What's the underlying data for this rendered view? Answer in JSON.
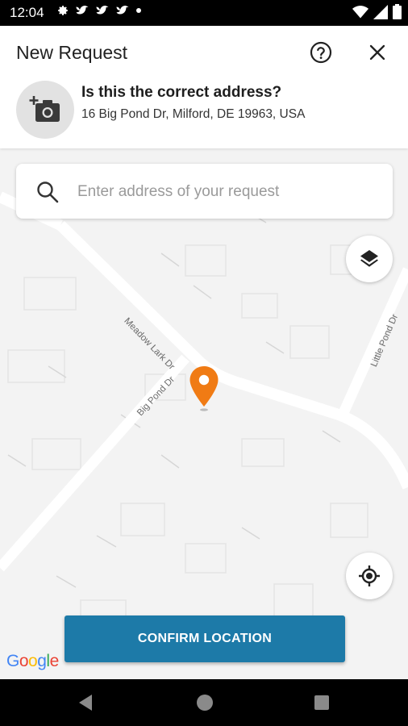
{
  "status_bar": {
    "time": "12:04"
  },
  "header": {
    "title": "New Request",
    "question": "Is this the correct address?",
    "address": "16 Big Pond Dr, Milford, DE 19963, USA"
  },
  "search": {
    "placeholder": "Enter address of your request"
  },
  "map": {
    "streets": [
      "Meadow Lark Dr",
      "Big Pond Dr",
      "Little Pond Dr"
    ],
    "attribution": "Google",
    "pin_color": "#f07b14"
  },
  "confirm_button": {
    "label": "CONFIRM LOCATION",
    "color": "#1d7aa8"
  },
  "icons": [
    "gear-icon",
    "bird-icon",
    "wifi-icon",
    "battery-icon",
    "help-icon",
    "close-icon",
    "add-photo-icon",
    "search-icon",
    "layers-icon",
    "my-location-icon",
    "map-pin-icon",
    "back-icon",
    "home-icon",
    "recents-icon"
  ]
}
